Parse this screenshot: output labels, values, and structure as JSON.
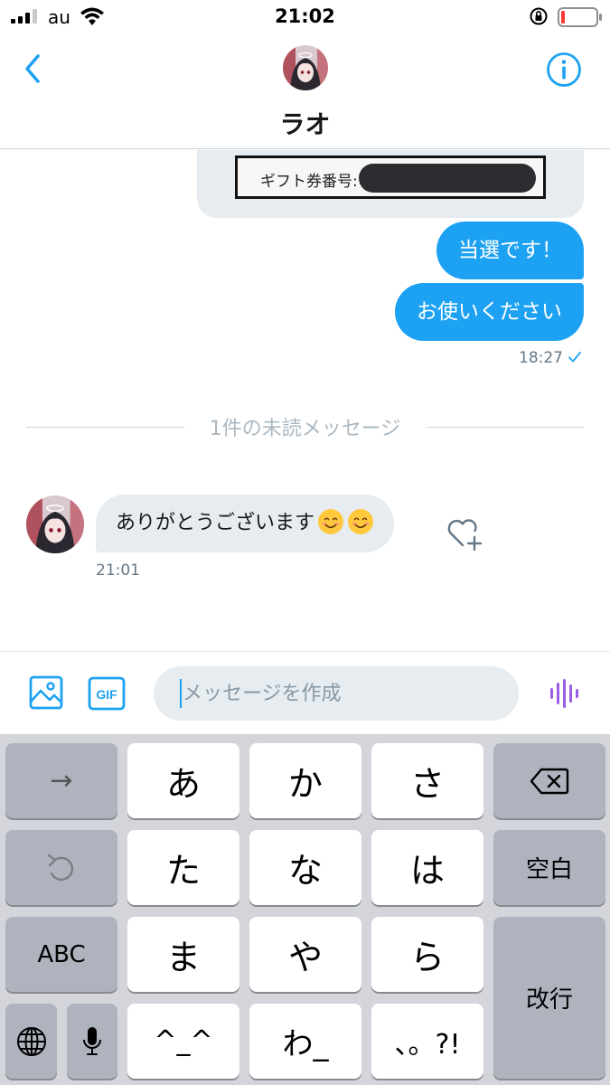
{
  "status_bar": {
    "carrier": "au",
    "time": "21:02",
    "battery_color": "#ff3b30"
  },
  "header": {
    "name": "ラオ",
    "back_icon": "chevron-left-icon",
    "info_icon": "info-icon"
  },
  "conversation": {
    "gift_card": {
      "label": "ギフト券番号:"
    },
    "sent_messages": [
      "当選です！",
      "お使いください"
    ],
    "sent_time": "18:27",
    "unread_divider": "1件の未読メッセージ",
    "received_message": {
      "text": "ありがとうございます",
      "emojis": [
        "smiling-face-icon",
        "smiling-face-icon"
      ],
      "time": "21:01"
    }
  },
  "composer": {
    "placeholder": "メッセージを作成",
    "gif_label": "GIF"
  },
  "keyboard": {
    "arrow": "→",
    "a": "あ",
    "ka": "か",
    "sa": "さ",
    "ta": "た",
    "na": "な",
    "ha": "は",
    "space": "空白",
    "abc": "ABC",
    "ma": "ま",
    "ya": "や",
    "ra": "ら",
    "return": "改行",
    "kaomoji": "^_^",
    "wa": "わ_",
    "punct": "、。?!"
  },
  "colors": {
    "accent": "#1da1f2",
    "bubble_in": "#e6ecf0",
    "voice": "#9b5de5"
  }
}
